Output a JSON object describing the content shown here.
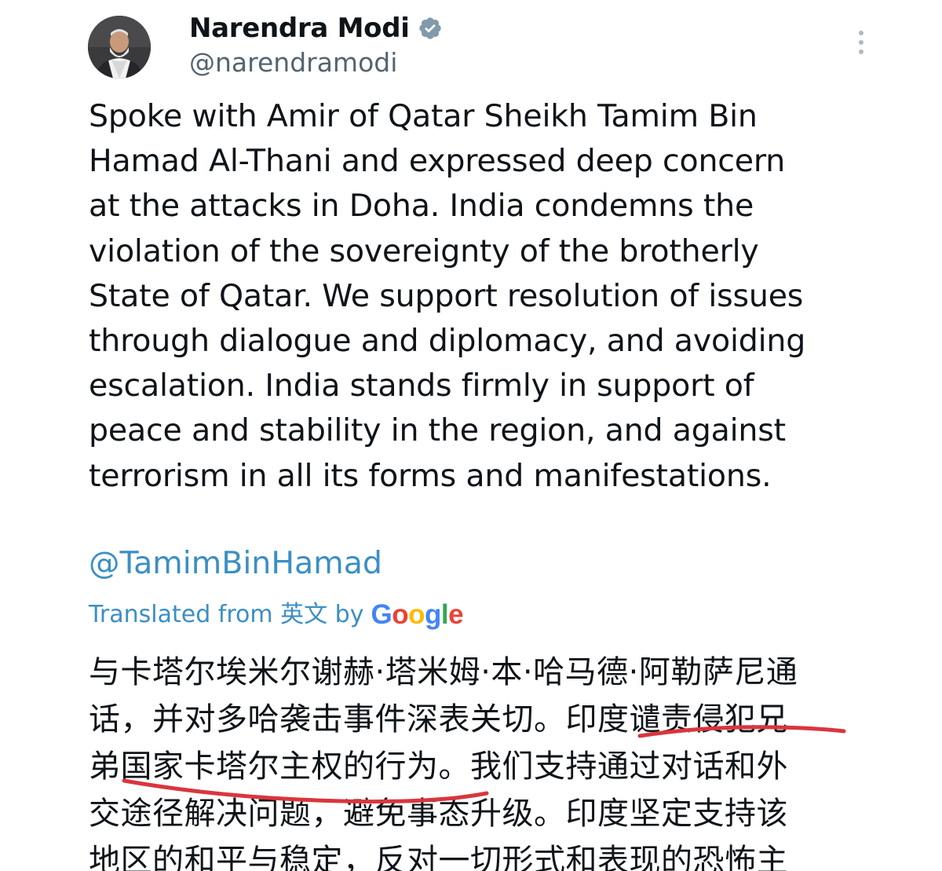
{
  "author": {
    "display_name": "Narendra Modi",
    "handle": "@narendramodi",
    "verified": true,
    "avatar_icon": "profile-photo"
  },
  "menu": {
    "icon": "more-vertical-icon"
  },
  "tweet": {
    "lines": [
      "Spoke with Amir of Qatar Sheikh Tamim Bin",
      "Hamad Al-Thani and expressed deep concern",
      "at the attacks in Doha. India condemns the",
      "violation of the sovereignty of the brotherly",
      "State of Qatar. We support resolution of issues",
      "through dialogue and diplomacy, and avoiding",
      "escalation. India stands firmly in support of",
      "peace and stability in the region, and against",
      "terrorism in all its forms and manifestations."
    ],
    "mention": "@TamimBinHamad"
  },
  "translation": {
    "label": "Translated from 英文 by",
    "provider": "Google",
    "lines": [
      "与卡塔尔埃米尔谢赫·塔米姆·本·哈马德·阿勒萨尼通",
      "话，并对多哈袭击事件深表关切。印度谴责侵犯兄",
      "弟国家卡塔尔主权的行为。我们支持通过对话和外",
      "交途径解决问题，避免事态升级。印度坚定支持该",
      "地区的和平与稳定，反对一切形式和表现的恐怖主"
    ]
  },
  "colors": {
    "text": "#0f1419",
    "secondary": "#536471",
    "link": "#3b8fc4",
    "verified": "#829aab",
    "annotation": "#d9363e"
  }
}
